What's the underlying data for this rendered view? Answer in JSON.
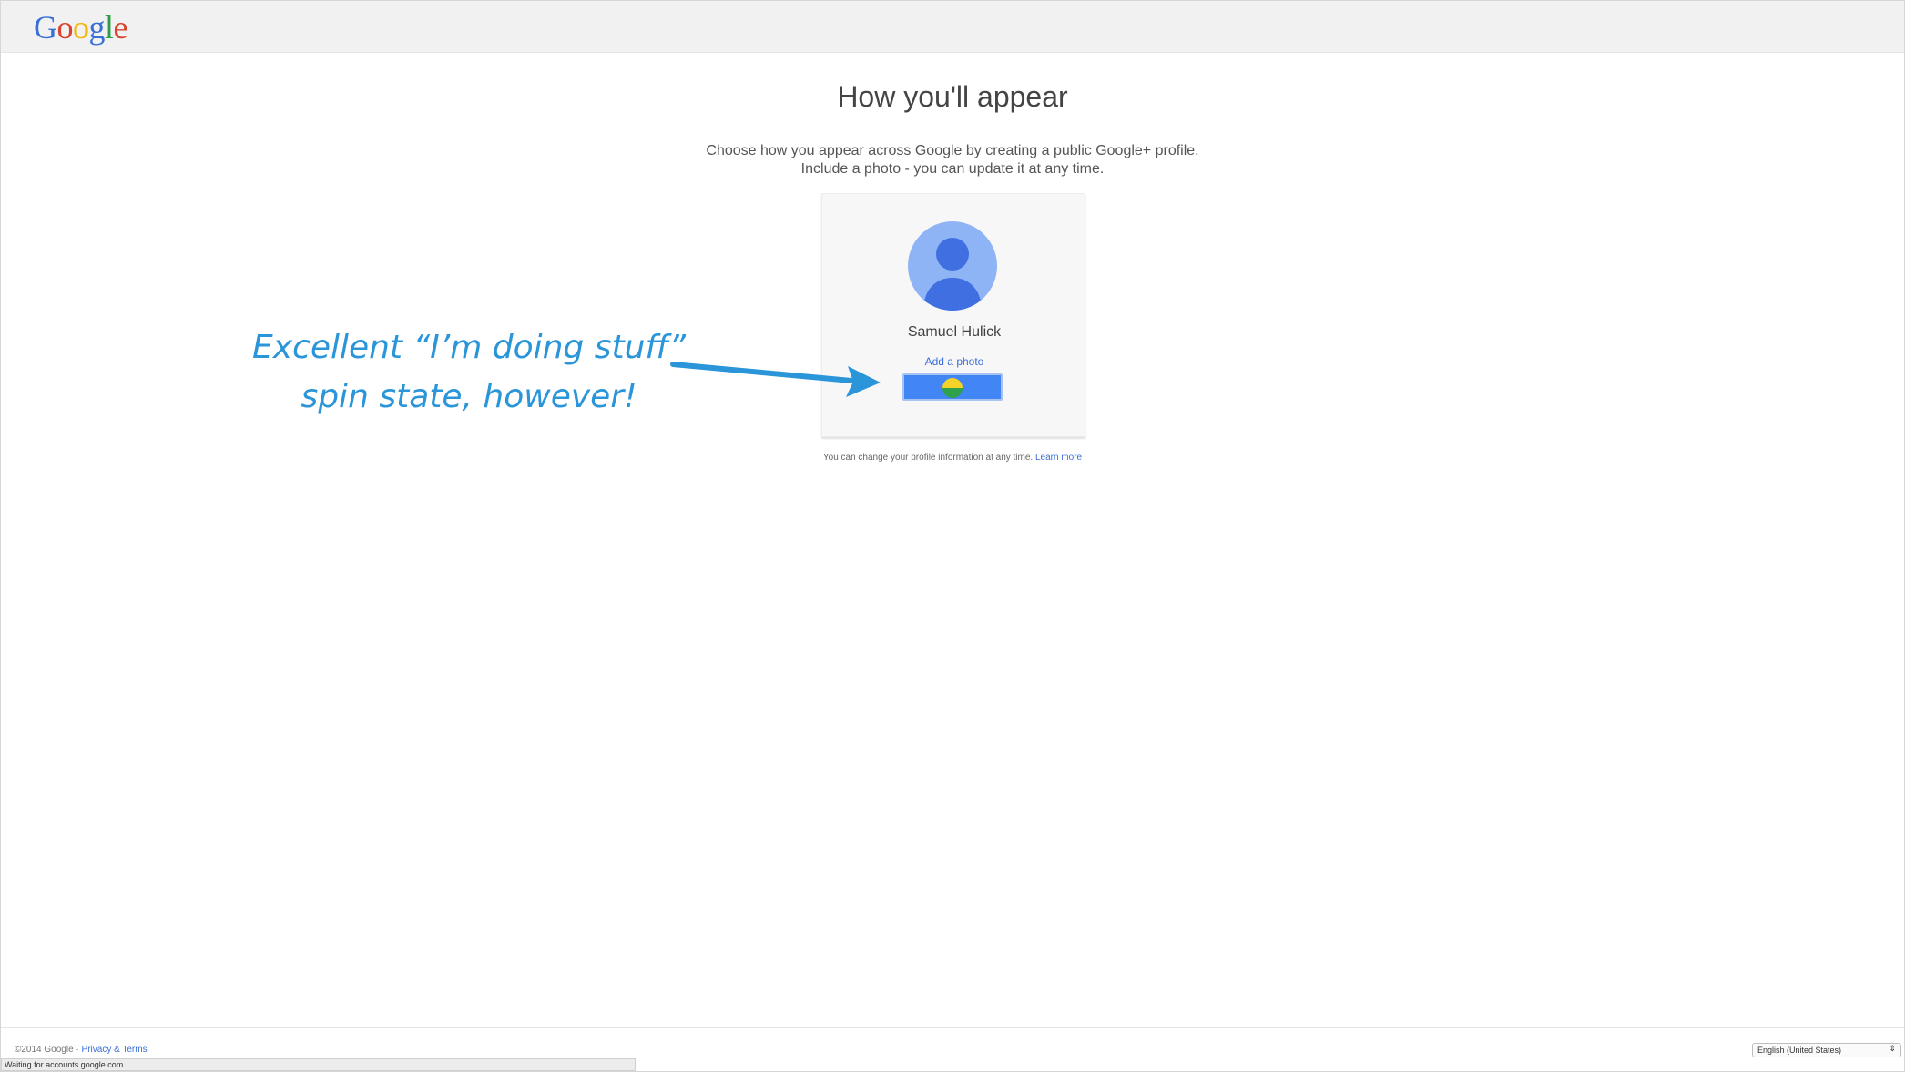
{
  "header": {
    "logo": [
      {
        "ch": "G",
        "color": "#3b6fd8"
      },
      {
        "ch": "o",
        "color": "#d7442f"
      },
      {
        "ch": "o",
        "color": "#f2b70a"
      },
      {
        "ch": "g",
        "color": "#3b6fd8"
      },
      {
        "ch": "l",
        "color": "#2e9d4b"
      },
      {
        "ch": "e",
        "color": "#d7442f"
      }
    ]
  },
  "main": {
    "title": "How you'll appear",
    "subtitle_line1": "Choose how you appear across Google by creating a public Google+ profile.",
    "subtitle_line2": "Include a photo - you can update it at any time.",
    "profile": {
      "name": "Samuel Hulick",
      "add_photo_link": "Add a photo",
      "avatar_icon": "person-avatar-icon",
      "button_icon": "loading-spinner-icon"
    },
    "footnote_text": "You can change your profile information at any time.",
    "footnote_link": "Learn more"
  },
  "annotation": {
    "line1": "Excellent “I’m doing stuff”",
    "line2": "spin state, however!",
    "color": "#2a95d8"
  },
  "footer": {
    "copyright": "©2014 Google ·",
    "privacy_link": "Privacy & Terms",
    "language": "English (United States)"
  },
  "status_bar": {
    "text": "Waiting for accounts.google.com..."
  },
  "colors": {
    "accent_blue": "#4285f4",
    "link_blue": "#3a6fd8"
  }
}
